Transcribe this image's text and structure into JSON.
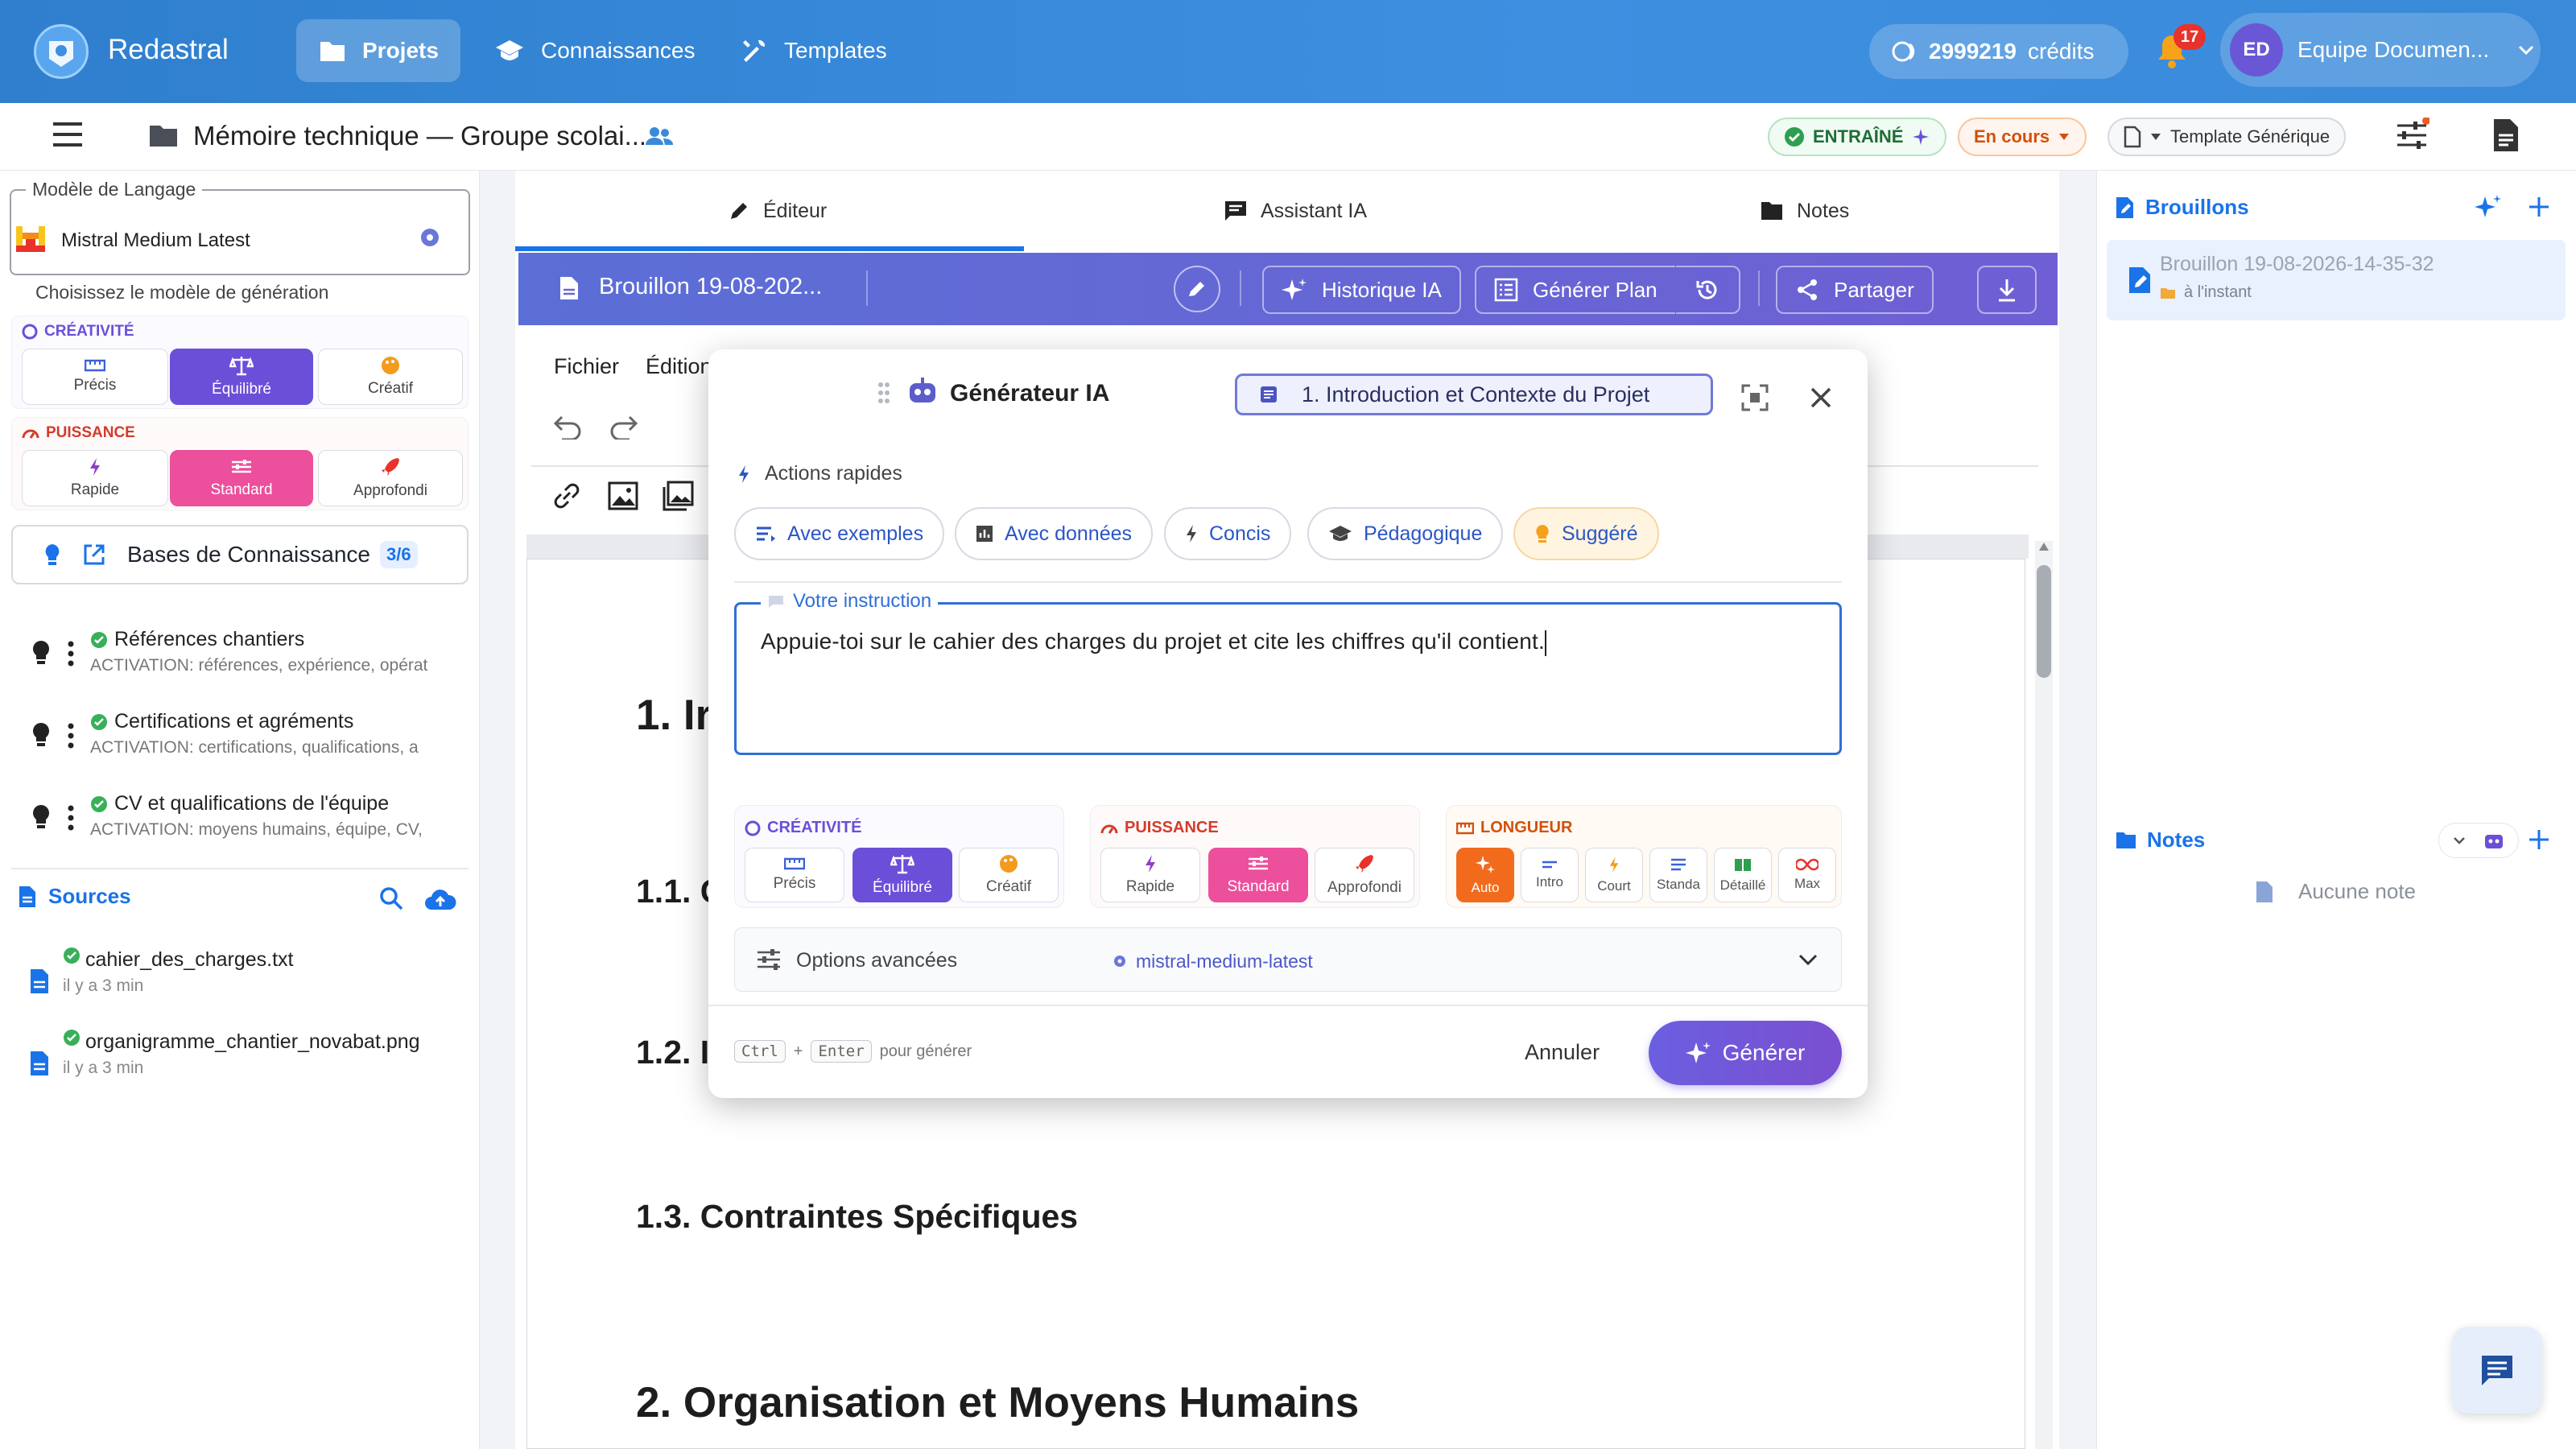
{
  "topbar": {
    "brand": "Redastral",
    "nav": [
      {
        "label": "Projets",
        "icon": "folder-icon"
      },
      {
        "label": "Connaissances",
        "icon": "school-icon"
      },
      {
        "label": "Templates",
        "icon": "tools-icon"
      }
    ],
    "credits_value": "2999219",
    "credits_label": "crédits",
    "notifications_count": "17",
    "user_initials": "ED",
    "user_name": "Equipe Documen..."
  },
  "subbar": {
    "project_title": "Mémoire technique — Groupe scolai...",
    "trained_badge": "ENTRAÎNÉ",
    "status_badge": "En cours",
    "template_label": "Template Générique"
  },
  "left": {
    "llm_legend": "Modèle de Langage",
    "llm_value": "Mistral Medium Latest",
    "llm_helper": "Choisissez le modèle de génération",
    "creativity": {
      "title": "CRÉATIVITÉ",
      "options": [
        "Précis",
        "Équilibré",
        "Créatif"
      ],
      "selected": "Équilibré"
    },
    "power": {
      "title": "PUISSANCE",
      "options": [
        "Rapide",
        "Standard",
        "Approfondi"
      ],
      "selected": "Standard"
    },
    "kb_button": "Bases de Connaissance",
    "kb_count": "3/6",
    "kb_items": [
      {
        "title": "Références chantiers",
        "subtitle": "ACTIVATION: références, expérience, opérat"
      },
      {
        "title": "Certifications et agréments",
        "subtitle": "ACTIVATION: certifications, qualifications, a"
      },
      {
        "title": "CV et qualifications de l'équipe",
        "subtitle": "ACTIVATION: moyens humains, équipe, CV,"
      }
    ],
    "sources_title": "Sources",
    "sources": [
      {
        "name": "cahier_des_charges.txt",
        "time": "il y a 3 min"
      },
      {
        "name": "organigramme_chantier_novabat.png",
        "time": "il y a 3 min"
      }
    ]
  },
  "editor": {
    "tabs": [
      "Éditeur",
      "Assistant IA",
      "Notes"
    ],
    "doc_title": "Brouillon 19-08-202...",
    "buttons": {
      "history": "Historique IA",
      "plan": "Générer Plan",
      "share": "Partager"
    },
    "menu": [
      "Fichier",
      "Édition"
    ],
    "headings": [
      {
        "text": "1. Ir",
        "level": 1
      },
      {
        "text": "1.1. C",
        "level": 2
      },
      {
        "text": "1.2. I",
        "level": 2
      },
      {
        "text": "1.3. Contraintes Spécifiques",
        "level": 2
      },
      {
        "text": "2. Organisation et Moyens Humains",
        "level": 1
      }
    ]
  },
  "modal": {
    "title": "Générateur IA",
    "section_chip": "1. Introduction et Contexte du Projet",
    "quick_actions_label": "Actions rapides",
    "quick_actions": [
      "Avec exemples",
      "Avec données",
      "Concis",
      "Pédagogique",
      "Suggéré"
    ],
    "instruction_label": "Votre instruction",
    "instruction_value": "Appuie-toi sur le cahier des charges du projet et cite les chiffres qu'il contient.",
    "creativity": {
      "title": "CRÉATIVITÉ",
      "options": [
        "Précis",
        "Équilibré",
        "Créatif"
      ],
      "selected": "Équilibré"
    },
    "power": {
      "title": "PUISSANCE",
      "options": [
        "Rapide",
        "Standard",
        "Approfondi"
      ],
      "selected": "Standard"
    },
    "length": {
      "title": "LONGUEUR",
      "options": [
        "Auto",
        "Intro",
        "Court",
        "Standa",
        "Détaillé",
        "Max"
      ],
      "selected": "Auto"
    },
    "advanced_label": "Options avancées",
    "advanced_model": "mistral-medium-latest",
    "kbd_ctrl": "Ctrl",
    "kbd_plus": "+",
    "kbd_enter": "Enter",
    "kbd_hint": "pour générer",
    "cancel": "Annuler",
    "generate": "Générer"
  },
  "right": {
    "drafts_title": "Brouillons",
    "draft_name": "Brouillon 19-08-2026-14-35-32",
    "draft_time": "à l'instant",
    "notes_title": "Notes",
    "notes_empty": "Aucune note"
  },
  "colors": {
    "primary": "#3a8ad9",
    "accent": "#6b4fd8",
    "pink": "#e8489a",
    "orange": "#f07a1a",
    "success": "#2e9e4f"
  }
}
